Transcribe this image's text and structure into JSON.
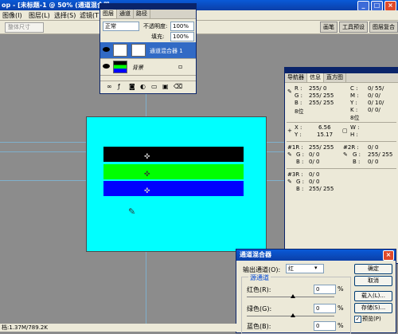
{
  "titlebar": {
    "title": "op - [未标题-1 @ 50% (通道混合器",
    "min": "_",
    "max": "□",
    "close": "×"
  },
  "menu": {
    "items": [
      "图像(I)",
      "图层(L)",
      "选择(S)",
      "滤镜(T)"
    ]
  },
  "options": {
    "field": "整体尺寸"
  },
  "palette_well": {
    "tabs": [
      "画笔",
      "工具预设",
      "图层复合"
    ]
  },
  "layers": {
    "tabs": [
      "图层",
      "通道",
      "路径"
    ],
    "blend_mode": "正常",
    "opacity_label": "不透明度:",
    "opacity_value": "100%",
    "fill_label": "填充:",
    "fill_value": "100%",
    "items": [
      {
        "name": "通道混合器 1"
      },
      {
        "name": "背景"
      }
    ]
  },
  "info": {
    "tabs": [
      "导航器",
      "信息",
      "直方图"
    ],
    "r1": {
      "label": "R :",
      "val": "255/ 0"
    },
    "g1": {
      "label": "G :",
      "val": "255/ 255"
    },
    "b1": {
      "label": "B :",
      "val": "255/ 255"
    },
    "c1": {
      "label": "C :",
      "val": "0/ 55/"
    },
    "m1": {
      "label": "M :",
      "val": "0/ 0/"
    },
    "y1": {
      "label": "Y :",
      "val": "0/ 10/"
    },
    "k1": {
      "label": "K :",
      "val": "0/ 0/"
    },
    "bit1": "8位",
    "bit2": "8位",
    "x": {
      "label": "X :",
      "val": "6.56"
    },
    "y": {
      "label": "Y :",
      "val": "15.17"
    },
    "w": "W :",
    "h": "H :",
    "s1": {
      "hdr": "#1R :",
      "r": "255/ 255",
      "g": "0/ 0",
      "b": "0/ 0"
    },
    "s2": {
      "hdr": "#2R :",
      "r": "0/ 0",
      "g": "255/ 255",
      "b": "0/ 0"
    },
    "s3": {
      "hdr": "#3R :",
      "r": "0/ 0",
      "g": "0/ 0",
      "b": "255/ 255"
    },
    "g_label": "G :",
    "b_label": "B :"
  },
  "mixer": {
    "title": "通道混合器",
    "output_label": "输出通道(O):",
    "output_value": "红",
    "source_label": "源通道",
    "red_label": "红色(R):",
    "red_value": "0",
    "green_label": "绿色(G):",
    "green_value": "0",
    "blue_label": "蓝色(B):",
    "blue_value": "0",
    "const_label": "常数(N):",
    "const_value": "0",
    "pct": "%",
    "ok": "确定",
    "cancel": "取消",
    "load": "载入(L)...",
    "save": "存储(S)...",
    "preview": "预览(P)",
    "preview_checked": true
  },
  "status": {
    "text": "档:1.37M/789.2K"
  },
  "colors": {
    "canvas": "#00ffff",
    "band1": "#000000",
    "band2": "#00ff00",
    "band3": "#0000ff"
  }
}
